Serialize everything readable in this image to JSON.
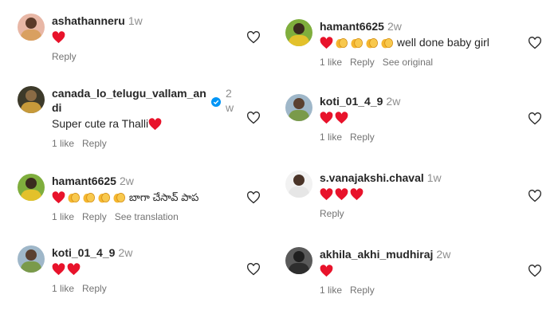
{
  "comments_left": [
    {
      "username": "ashathanneru",
      "time": "1w",
      "text": "",
      "emoji": [
        "heart"
      ],
      "likes": "",
      "reply": "Reply",
      "extra": ""
    },
    {
      "username_line1": "canada_lo_telugu_vallam_an",
      "username_line2": "di",
      "time_line1": "2",
      "time_line2": "w",
      "text": "Super cute ra Thalli",
      "emoji": [
        "heart"
      ],
      "likes": "1 like",
      "reply": "Reply",
      "extra": ""
    },
    {
      "username": "hamant6625",
      "time": "2w",
      "text": "బాగా చేసావ్ పాప",
      "emoji": [
        "heart",
        "clap",
        "clap",
        "clap",
        "clap"
      ],
      "likes": "1 like",
      "reply": "Reply",
      "extra": "See translation"
    },
    {
      "username": "koti_01_4_9",
      "time": "2w",
      "text": "",
      "emoji": [
        "heart",
        "heart"
      ],
      "likes": "1 like",
      "reply": "Reply",
      "extra": ""
    }
  ],
  "comments_right": [
    {
      "username": "hamant6625",
      "time": "2w",
      "text": "well done baby girl",
      "emoji": [
        "heart",
        "clap",
        "clap",
        "clap",
        "clap"
      ],
      "likes": "1 like",
      "reply": "Reply",
      "extra": "See original"
    },
    {
      "username": "koti_01_4_9",
      "time": "2w",
      "text": "",
      "emoji": [
        "heart",
        "heart"
      ],
      "likes": "1 like",
      "reply": "Reply",
      "extra": ""
    },
    {
      "username": "s.vanajakshi.chaval",
      "time": "1w",
      "text": "",
      "emoji": [
        "heart",
        "heart",
        "heart"
      ],
      "likes": "",
      "reply": "Reply",
      "extra": ""
    },
    {
      "username": "akhila_akhi_mudhiraj",
      "time": "2w",
      "text": "",
      "emoji": [
        "heart"
      ],
      "likes": "1 like",
      "reply": "Reply",
      "extra": ""
    }
  ],
  "colors": {
    "heart": "#e8132b",
    "clap": "#f5b731",
    "meta": "#737373",
    "verified": "#0095f6"
  },
  "icons": {
    "like": "heart-outline-icon",
    "verified": "verified-badge-icon"
  }
}
